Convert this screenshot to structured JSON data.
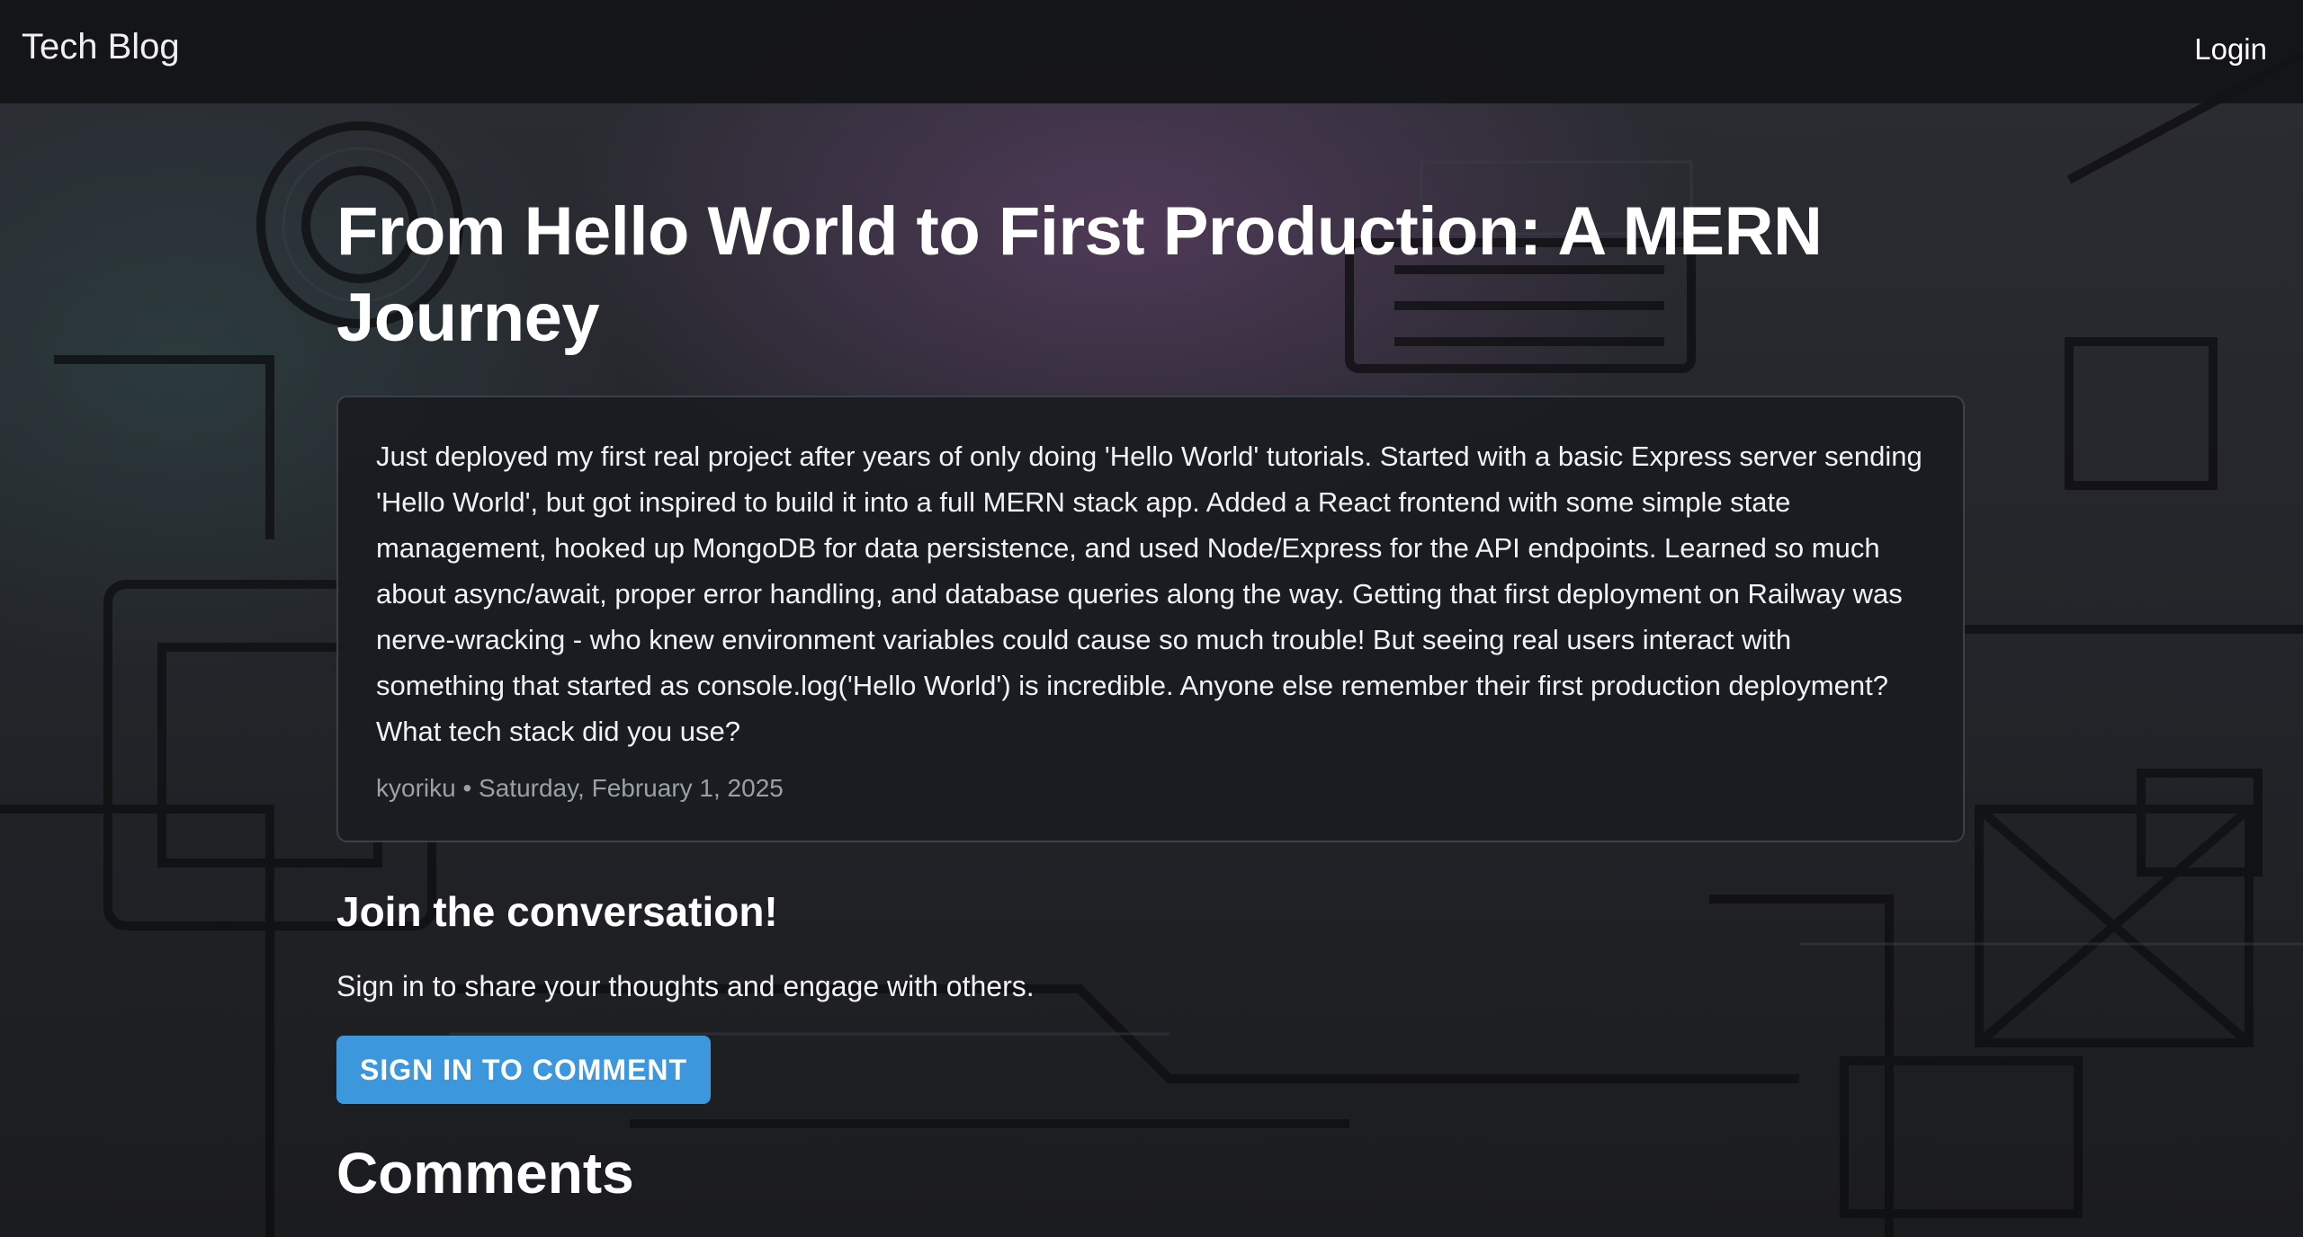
{
  "nav": {
    "brand": "Tech Blog",
    "login_label": "Login"
  },
  "post": {
    "title": "From Hello World to First Production: A MERN Journey",
    "body": "Just deployed my first real project after years of only doing 'Hello World' tutorials. Started with a basic Express server sending 'Hello World', but got inspired to build it into a full MERN stack app. Added a React frontend with some simple state management, hooked up MongoDB for data persistence, and used Node/Express for the API endpoints. Learned so much about async/await, proper error handling, and database queries along the way. Getting that first deployment on Railway was nerve-wracking - who knew environment variables could cause so much trouble! But seeing real users interact with something that started as console.log('Hello World') is incredible. Anyone else remember their first production deployment? What tech stack did you use?",
    "meta": "kyoriku • Saturday, February 1, 2025"
  },
  "join": {
    "title": "Join the conversation!",
    "text": "Sign in to share your thoughts and engage with others.",
    "button_label": "SIGN IN TO COMMENT"
  },
  "comments": {
    "title": "Comments"
  },
  "colors": {
    "accent": "#3d97dc",
    "navbar": "#121416",
    "card": "#191c20"
  }
}
